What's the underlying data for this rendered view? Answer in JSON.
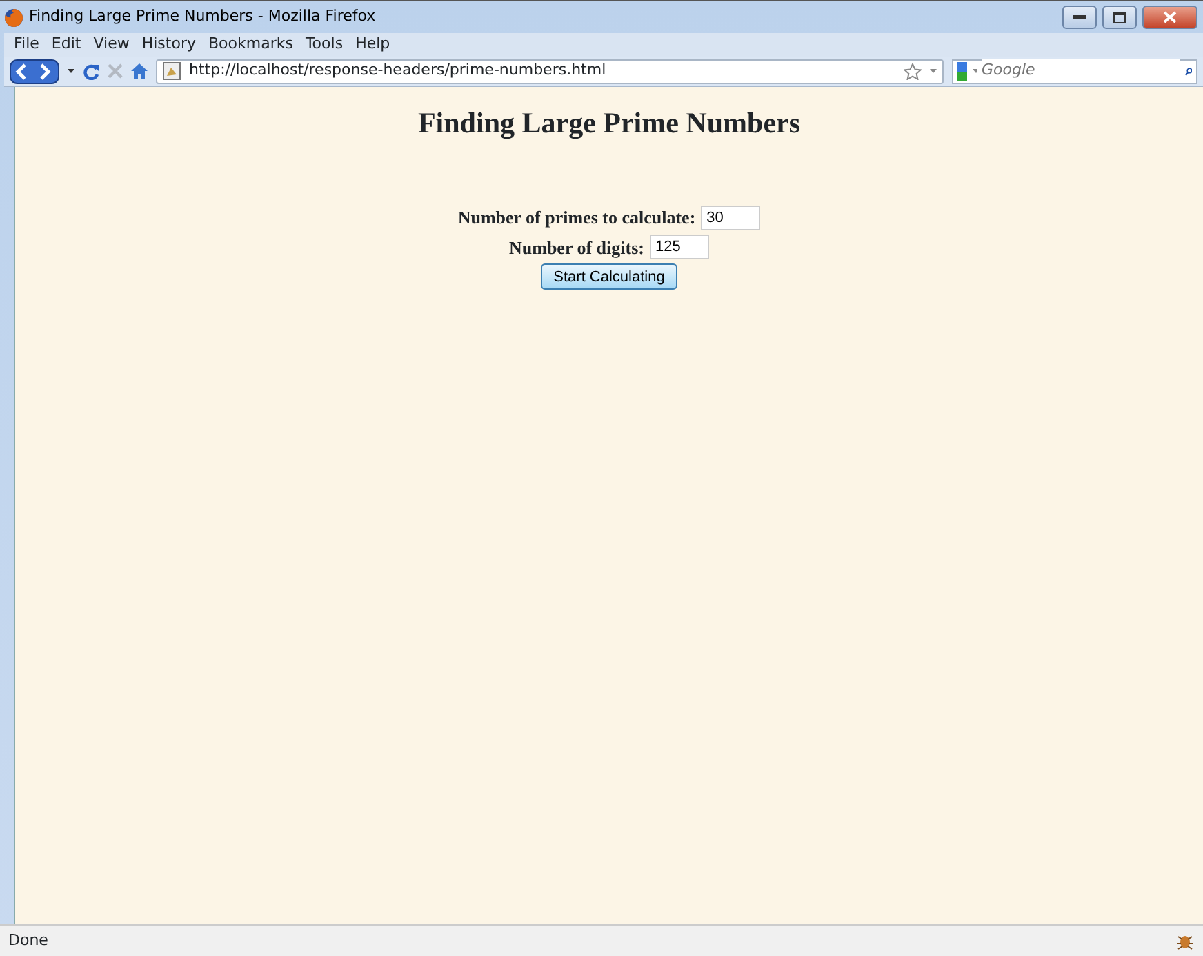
{
  "window": {
    "title": "Finding Large Prime Numbers - Mozilla Firefox"
  },
  "menu": [
    "File",
    "Edit",
    "View",
    "History",
    "Bookmarks",
    "Tools",
    "Help"
  ],
  "toolbar": {
    "url": "http://localhost/response-headers/prime-numbers.html",
    "search_placeholder": "Google"
  },
  "page": {
    "heading": "Finding Large Prime Numbers",
    "fields": [
      {
        "label": "Number of primes to calculate:",
        "value": "30"
      },
      {
        "label": "Number of digits:",
        "value": "125"
      }
    ],
    "button": "Start Calculating"
  },
  "status_bar": "Done"
}
